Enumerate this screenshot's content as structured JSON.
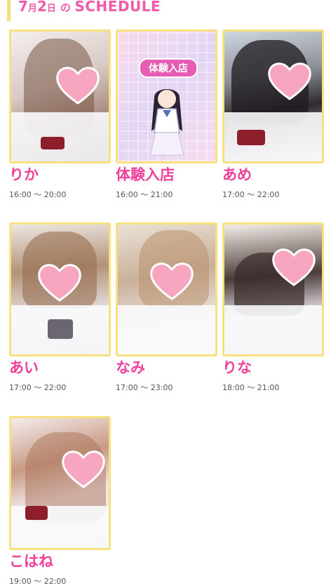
{
  "header": {
    "month": "7",
    "month_unit": "月",
    "day": "2",
    "day_unit": "日",
    "no": "の",
    "schedule": "SCHEDULE"
  },
  "cards": [
    {
      "name": "りか",
      "time": "16:00 〜 20:00"
    },
    {
      "name": "体験入店",
      "time": "16:00 〜 21:00",
      "badge": "体験入店"
    },
    {
      "name": "あめ",
      "time": "17:00 〜 22:00"
    },
    {
      "name": "あい",
      "time": "17:00 〜 22:00"
    },
    {
      "name": "なみ",
      "time": "17:00 〜 23:00"
    },
    {
      "name": "りな",
      "time": "18:00 〜 21:00"
    },
    {
      "name": "こはね",
      "time": "19:00 〜 22:00"
    }
  ],
  "colors": {
    "accent_pink": "#f0419a",
    "frame_yellow": "#f8e07e",
    "heart_pink": "#f8a6c0"
  }
}
